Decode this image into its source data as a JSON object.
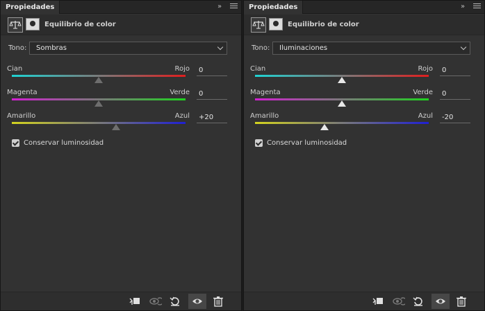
{
  "panels": [
    {
      "tab_title": "Propiedades",
      "collapse_glyph": "»",
      "header_title": "Equilibrio de color",
      "tono_label": "Tono:",
      "tono_value": "Sombras",
      "sliders": [
        {
          "left_label": "Cian",
          "right_label": "Rojo",
          "value": "0",
          "numeric": 0,
          "gradient": [
            "#1fd3d3",
            "#7a7a7a",
            "#e01e1e"
          ]
        },
        {
          "left_label": "Magenta",
          "right_label": "Verde",
          "value": "0",
          "numeric": 0,
          "gradient": [
            "#d31fd3",
            "#7a7a7a",
            "#1ed31e"
          ]
        },
        {
          "left_label": "Amarillo",
          "right_label": "Azul",
          "value": "+20",
          "numeric": 20,
          "gradient": [
            "#d3d31f",
            "#7a7a7a",
            "#1f1fd3"
          ]
        }
      ],
      "preserve_label": "Conservar luminosidad",
      "preserve_checked": true,
      "footer_icons": [
        "clip-to-layer-icon",
        "view-previous-state-icon",
        "reset-icon",
        "visibility-eye-icon",
        "trash-icon"
      ]
    },
    {
      "tab_title": "Propiedades",
      "collapse_glyph": "»",
      "header_title": "Equilibrio de color",
      "tono_label": "Tono:",
      "tono_value": "Iluminaciones",
      "sliders": [
        {
          "left_label": "Cian",
          "right_label": "Rojo",
          "value": "0",
          "numeric": 0,
          "gradient": [
            "#1fd3d3",
            "#7a7a7a",
            "#e01e1e"
          ]
        },
        {
          "left_label": "Magenta",
          "right_label": "Verde",
          "value": "0",
          "numeric": 0,
          "gradient": [
            "#d31fd3",
            "#7a7a7a",
            "#1ed31e"
          ]
        },
        {
          "left_label": "Amarillo",
          "right_label": "Azul",
          "value": "-20",
          "numeric": -20,
          "gradient": [
            "#d3d31f",
            "#7a7a7a",
            "#1f1fd3"
          ]
        }
      ],
      "preserve_label": "Conservar luminosidad",
      "preserve_checked": true,
      "footer_icons": [
        "clip-to-layer-icon",
        "view-previous-state-icon",
        "reset-icon",
        "visibility-eye-icon",
        "trash-icon"
      ]
    }
  ],
  "slider_range": [
    -100,
    100
  ]
}
